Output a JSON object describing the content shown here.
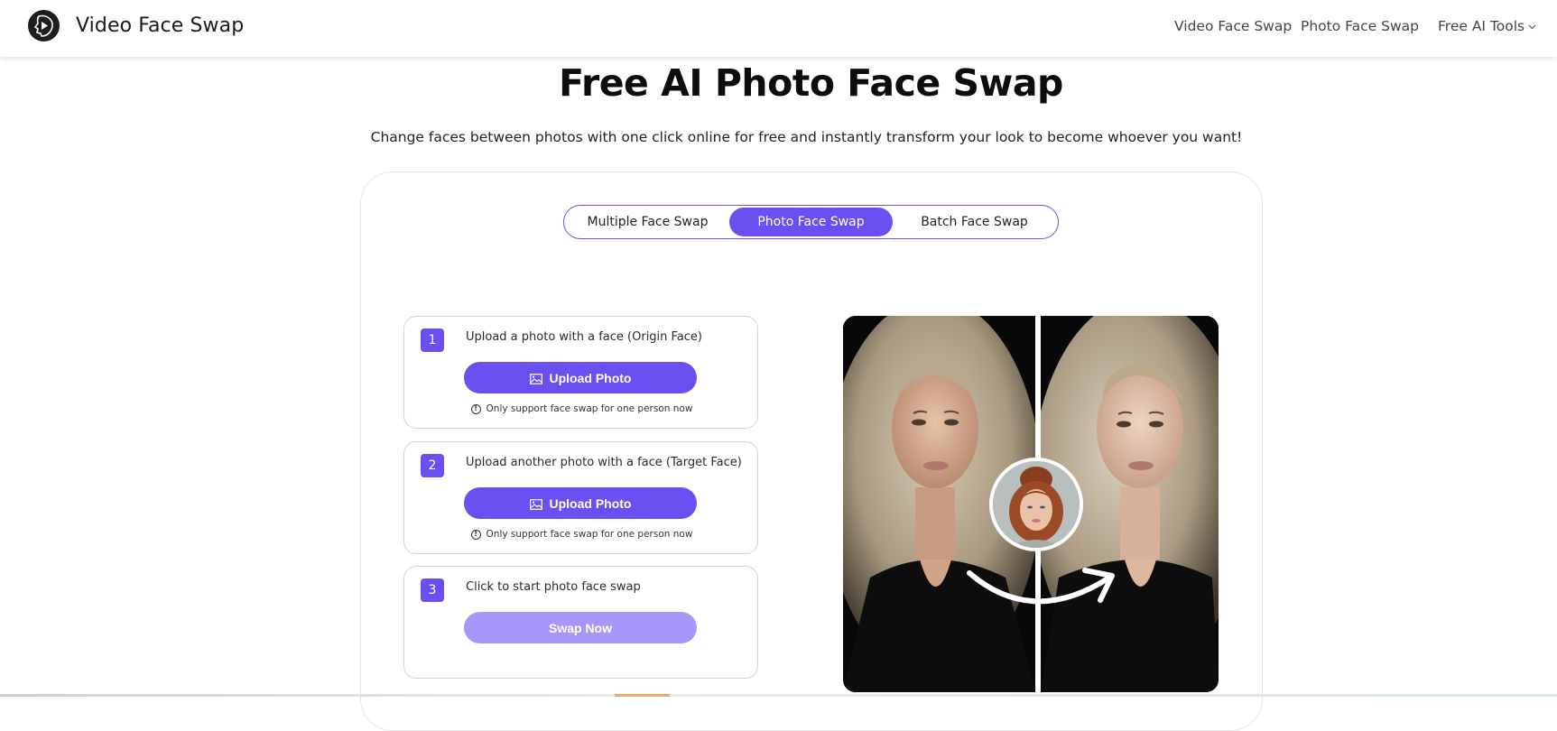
{
  "header": {
    "brand_name": "Video Face Swap",
    "logo_icon": "face-play-logo-icon",
    "nav": [
      {
        "label": "Video Face Swap"
      },
      {
        "label": "Photo Face Swap"
      },
      {
        "label": "Free AI Tools",
        "icon": "chevron-down-icon",
        "chevron": "⌄"
      }
    ]
  },
  "hero": {
    "title": "Free AI Photo Face Swap",
    "subtitle": "Change faces between photos with one click online for free and instantly transform your look to become whoever you want!"
  },
  "tabs": [
    {
      "label": "Multiple Face Swap",
      "active": false
    },
    {
      "label": "Photo Face Swap",
      "active": true
    },
    {
      "label": "Batch Face Swap",
      "active": false
    }
  ],
  "steps": [
    {
      "number": "1",
      "label": "Upload a photo with a face  (Origin Face)",
      "button": "Upload Photo",
      "button_icon": "image-icon",
      "note": "Only support face swap for one person now",
      "note_icon": "info-icon"
    },
    {
      "number": "2",
      "label": "Upload another photo with a face  (Target Face)",
      "button": "Upload Photo",
      "button_icon": "image-icon",
      "note": "Only support face swap for one person now",
      "note_icon": "info-icon"
    },
    {
      "number": "3",
      "label": "Click to start photo face swap",
      "button": "Swap Now",
      "button_disabled": true
    }
  ],
  "preview": {
    "description": "Before/after face swap example with source face thumbnail and curved arrow"
  },
  "colors": {
    "accent": "#6b4ff0",
    "accent_disabled": "#a797fb",
    "bottom_accent": "#f4a86c"
  }
}
